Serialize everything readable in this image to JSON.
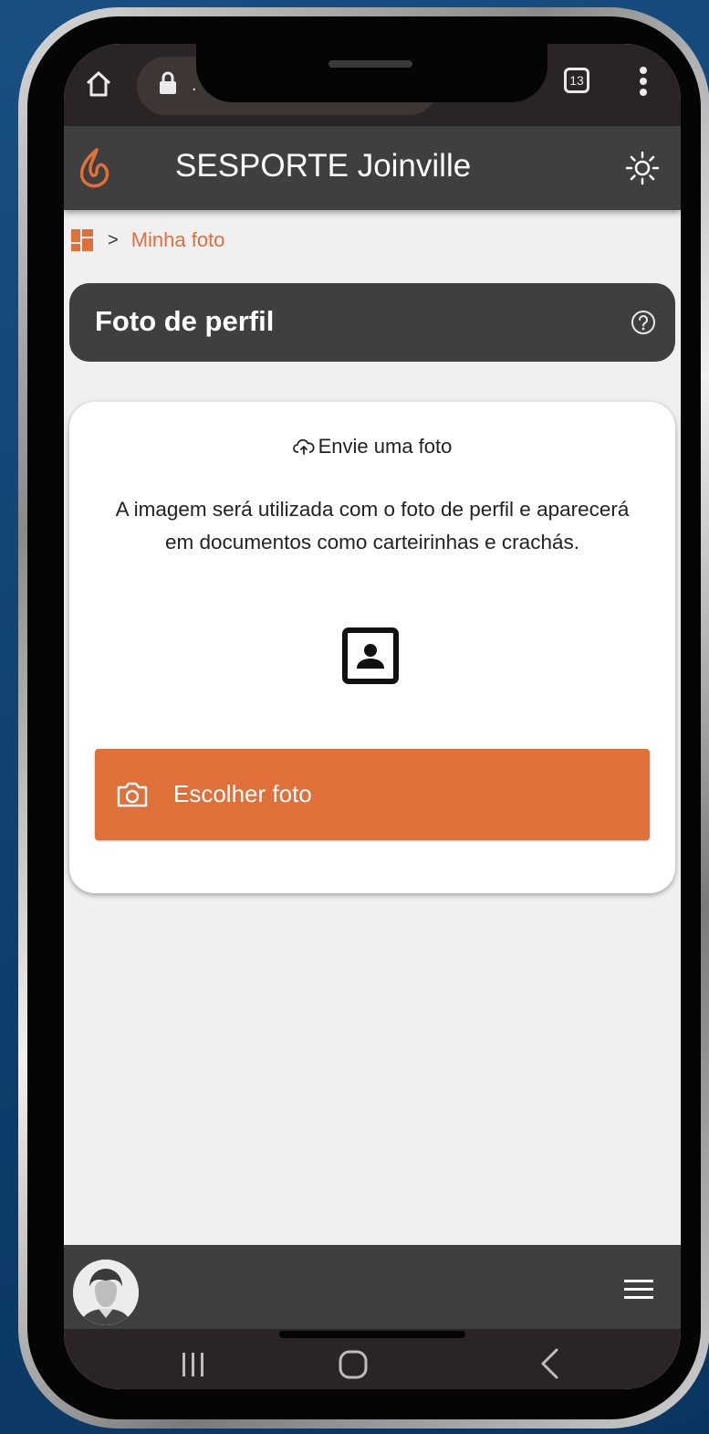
{
  "browser": {
    "url_fragment": ".",
    "tab_count": "13"
  },
  "header": {
    "title": "SESPORTE Joinville",
    "logo_icon": "flame-logo-icon",
    "theme_icon": "sun-icon"
  },
  "breadcrumb": {
    "home_icon": "dashboard-icon",
    "separator": ">",
    "current": "Minha foto"
  },
  "section": {
    "title": "Foto de perfil",
    "help_icon": "help-circle-icon"
  },
  "card": {
    "upload_label": "Envie uma foto",
    "description": "A imagem será utilizada com o foto de perfil e aparecerá em documentos como carteirinhas e crachás.",
    "portrait_icon": "portrait-icon",
    "choose_button_label": "Escolher foto",
    "choose_button_icon": "camera-icon"
  },
  "bottom_bar": {
    "avatar_icon": "user-avatar",
    "menu_icon": "hamburger-menu-icon"
  },
  "colors": {
    "accent": "#e0703a",
    "header_bg": "#3f3f3f",
    "page_bg": "#f0f0f0"
  }
}
